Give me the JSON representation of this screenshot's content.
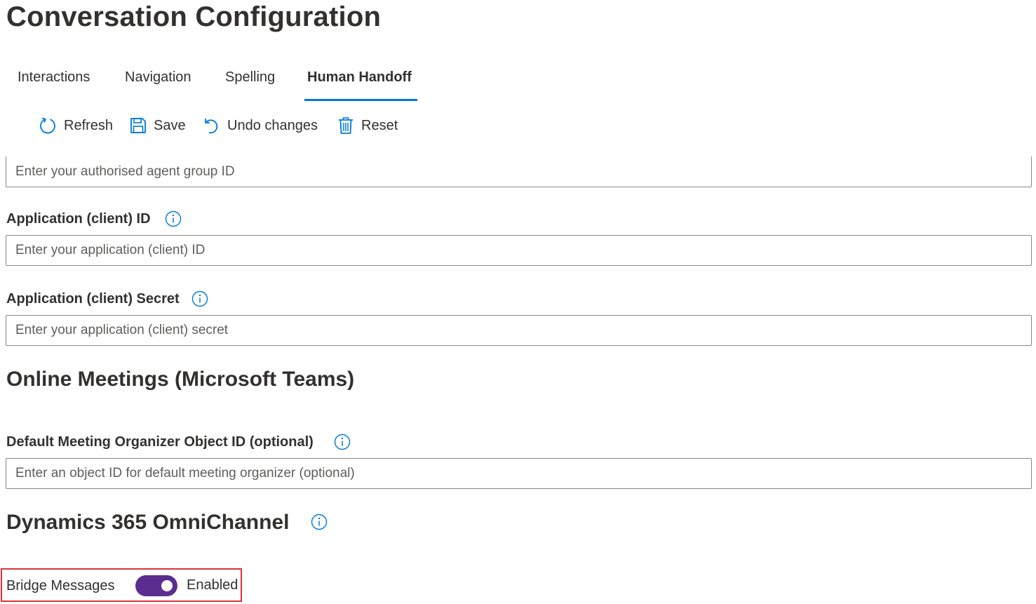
{
  "page": {
    "title": "Conversation Configuration"
  },
  "tabs": [
    {
      "label": "Interactions",
      "active": false
    },
    {
      "label": "Navigation",
      "active": false
    },
    {
      "label": "Spelling",
      "active": false
    },
    {
      "label": "Human Handoff",
      "active": true
    }
  ],
  "toolbar": {
    "refresh_label": "Refresh",
    "save_label": "Save",
    "undo_label": "Undo changes",
    "reset_label": "Reset",
    "icons": [
      "refresh-icon",
      "save-icon",
      "undo-icon",
      "delete-icon"
    ]
  },
  "fields": {
    "agent_group": {
      "placeholder": "Enter your authorised agent group ID",
      "value": ""
    },
    "client_id": {
      "label": "Application (client) ID",
      "placeholder": "Enter your application (client) ID",
      "value": ""
    },
    "client_secret": {
      "label": "Application (client) Secret",
      "placeholder": "Enter your application (client) secret",
      "value": ""
    },
    "organizer_id": {
      "label": "Default Meeting Organizer Object ID (optional)",
      "placeholder": "Enter an object ID for default meeting organizer (optional)",
      "value": ""
    }
  },
  "sections": {
    "online_meetings": {
      "title": "Online Meetings (Microsoft Teams)"
    },
    "omnichannel": {
      "title": "Dynamics 365 OmniChannel"
    }
  },
  "bridge_messages": {
    "label": "Bridge Messages",
    "state_text": "Enabled",
    "on": true
  },
  "colors": {
    "accent": "#0078d4",
    "toggle_on": "#5c2d91",
    "highlight": "#e0313b",
    "text": "#323130"
  }
}
